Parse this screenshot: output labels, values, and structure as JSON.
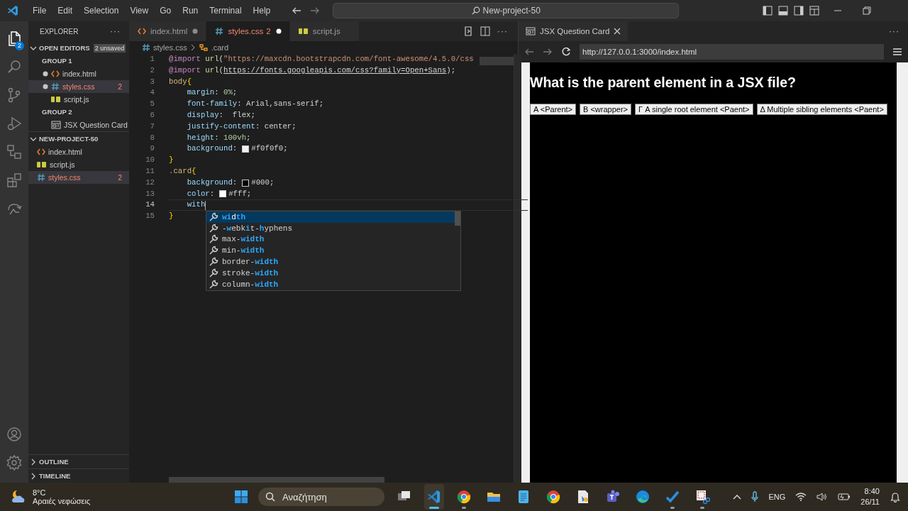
{
  "title_bar": {
    "menu": [
      "File",
      "Edit",
      "Selection",
      "View",
      "Go",
      "Run",
      "Terminal",
      "Help"
    ],
    "command_center": "New-project-50"
  },
  "activity_bar": {
    "explorer_badge": "2"
  },
  "sidebar": {
    "title": "EXPLORER",
    "more": "···",
    "open_editors": {
      "label": "OPEN EDITORS",
      "expanded": true,
      "badge": "2 unsaved",
      "groups": [
        {
          "label": "GROUP 1",
          "files": [
            {
              "name": "index.html",
              "kind": "html",
              "dirty": true,
              "selected": false
            },
            {
              "name": "styles.css",
              "kind": "css",
              "dirty": true,
              "problems": "2",
              "selected": true
            },
            {
              "name": "script.js",
              "kind": "js",
              "dirty": false,
              "selected": false
            }
          ]
        },
        {
          "label": "GROUP 2",
          "files": [
            {
              "name": "JSX Question Card",
              "kind": "preview",
              "dirty": false,
              "selected": false
            }
          ]
        }
      ]
    },
    "project": {
      "label": "NEW-PROJECT-50",
      "expanded": true,
      "files": [
        {
          "name": "index.html",
          "kind": "html",
          "selected": false
        },
        {
          "name": "script.js",
          "kind": "js",
          "selected": false
        },
        {
          "name": "styles.css",
          "kind": "css",
          "problems": "2",
          "selected": true
        }
      ]
    },
    "bottom_sections": [
      {
        "label": "OUTLINE",
        "expanded": false
      },
      {
        "label": "TIMELINE",
        "expanded": false
      }
    ]
  },
  "editor": {
    "tabs": [
      {
        "name": "index.html",
        "kind": "html",
        "dirty": true,
        "selected": false
      },
      {
        "name": "styles.css",
        "kind": "css",
        "dirty": true,
        "problems": "2",
        "selected": true
      },
      {
        "name": "script.js",
        "kind": "js",
        "dirty": false,
        "selected": false
      }
    ],
    "more": "···",
    "breadcrumb": [
      {
        "text": "styles.css",
        "kind": "css"
      },
      {
        "text": ".card",
        "kind": "selector"
      }
    ],
    "lines": [
      {
        "number": "1",
        "current": false,
        "indented": false,
        "tokens": [
          {
            "kind": "at",
            "t": "@import "
          },
          {
            "kind": "fn",
            "t": "url"
          },
          {
            "kind": "p",
            "t": "("
          },
          {
            "kind": "str",
            "t": "\"https://maxcdn.bootstrapcdn.com/font-awesome/4.5.0/css"
          }
        ]
      },
      {
        "number": "2",
        "current": false,
        "indented": false,
        "tokens": [
          {
            "kind": "at",
            "t": "@import "
          },
          {
            "kind": "fn",
            "t": "url"
          },
          {
            "kind": "p",
            "t": "("
          },
          {
            "kind": "link",
            "t": "https://fonts.googleapis.com/css?family=Open+Sans"
          },
          {
            "kind": "p",
            "t": ");"
          }
        ]
      },
      {
        "number": "3",
        "current": false,
        "indented": false,
        "tokens": [
          {
            "kind": "sel",
            "t": "body"
          },
          {
            "kind": "brace",
            "t": "{"
          }
        ]
      },
      {
        "number": "4",
        "current": false,
        "indented": true,
        "tokens": [
          {
            "kind": "prop",
            "t": "margin"
          },
          {
            "kind": "p",
            "t": ": "
          },
          {
            "kind": "num",
            "t": "0%"
          },
          {
            "kind": "p",
            "t": ";"
          }
        ]
      },
      {
        "number": "5",
        "current": false,
        "indented": true,
        "tokens": [
          {
            "kind": "prop",
            "t": "font-family"
          },
          {
            "kind": "p",
            "t": ": Arial,sans-serif;"
          }
        ]
      },
      {
        "number": "6",
        "current": false,
        "indented": true,
        "tokens": [
          {
            "kind": "prop",
            "t": "display"
          },
          {
            "kind": "p",
            "t": ":  flex;"
          }
        ]
      },
      {
        "number": "7",
        "current": false,
        "indented": true,
        "tokens": [
          {
            "kind": "prop",
            "t": "justify-content"
          },
          {
            "kind": "p",
            "t": ": center;"
          }
        ]
      },
      {
        "number": "8",
        "current": false,
        "indented": true,
        "tokens": [
          {
            "kind": "prop",
            "t": "height"
          },
          {
            "kind": "p",
            "t": ": "
          },
          {
            "kind": "num",
            "t": "100vh"
          },
          {
            "kind": "p",
            "t": ";"
          }
        ]
      },
      {
        "number": "9",
        "current": false,
        "indented": true,
        "tokens": [
          {
            "kind": "prop",
            "t": "background"
          },
          {
            "kind": "p",
            "t": ":"
          },
          {
            "kind": "swatch",
            "color": "#f0f0f0"
          },
          {
            "kind": "p",
            "t": "#f0f0f0;"
          }
        ]
      },
      {
        "number": "10",
        "current": false,
        "indented": false,
        "tokens": [
          {
            "kind": "brace",
            "t": "}"
          }
        ]
      },
      {
        "number": "11",
        "current": false,
        "indented": false,
        "tokens": [
          {
            "kind": "sel",
            "t": ".card"
          },
          {
            "kind": "brace",
            "t": "{"
          }
        ]
      },
      {
        "number": "12",
        "current": false,
        "indented": true,
        "tokens": [
          {
            "kind": "prop",
            "t": "background"
          },
          {
            "kind": "p",
            "t": ":"
          },
          {
            "kind": "swatch",
            "color": "#000000"
          },
          {
            "kind": "p",
            "t": "#000;"
          }
        ]
      },
      {
        "number": "13",
        "current": false,
        "indented": true,
        "tokens": [
          {
            "kind": "prop",
            "t": "color"
          },
          {
            "kind": "p",
            "t": ":"
          },
          {
            "kind": "swatch",
            "color": "#ffffff"
          },
          {
            "kind": "p",
            "t": "#fff;"
          }
        ]
      },
      {
        "number": "14",
        "current": true,
        "indented": true,
        "tokens": [
          {
            "kind": "prop",
            "t": "with"
          }
        ]
      },
      {
        "number": "15",
        "current": false,
        "indented": false,
        "tokens": [
          {
            "kind": "brace",
            "t": "}"
          }
        ]
      }
    ],
    "suggestions": [
      {
        "label": "**wi**d**th**",
        "selected": true
      },
      {
        "label": "-**w**ebk**i**t-**h**yphens",
        "selected": false
      },
      {
        "label": "max-**width**",
        "selected": false
      },
      {
        "label": "min-**width**",
        "selected": false
      },
      {
        "label": "border-**width**",
        "selected": false
      },
      {
        "label": "stroke-**width**",
        "selected": false
      },
      {
        "label": "column-**width**",
        "selected": false
      }
    ]
  },
  "preview": {
    "tab": "JSX Question Card",
    "more": "···",
    "url": "http://127.0.0.1:3000/index.html",
    "question": "What is the parent element in a JSX file?",
    "answers": [
      "A <Parent>",
      "B <wrapper>",
      "Γ A single root element <Paent>",
      "Δ Multiple sibling elements <Paent>"
    ]
  },
  "taskbar": {
    "weather": {
      "temp": "8°C",
      "description": "Αραιές νεφώσεις"
    },
    "search_placeholder": "Αναζήτηση",
    "apps": [
      {
        "kind": "taskview",
        "running": false,
        "active": false
      },
      {
        "kind": "vscode",
        "running": true,
        "active": true
      },
      {
        "kind": "chrome",
        "running": true,
        "active": false
      },
      {
        "kind": "folder",
        "running": false,
        "active": false
      },
      {
        "kind": "notepad",
        "running": false,
        "active": false
      },
      {
        "kind": "chrome",
        "running": false,
        "active": false
      },
      {
        "kind": "document",
        "running": false,
        "active": false
      },
      {
        "kind": "teams",
        "running": false,
        "active": false
      },
      {
        "kind": "edge",
        "running": false,
        "active": false
      },
      {
        "kind": "todo",
        "running": true,
        "active": false
      },
      {
        "kind": "snip",
        "running": true,
        "active": false
      }
    ],
    "language": "ENG",
    "time": "8:40",
    "date": "26/11"
  }
}
